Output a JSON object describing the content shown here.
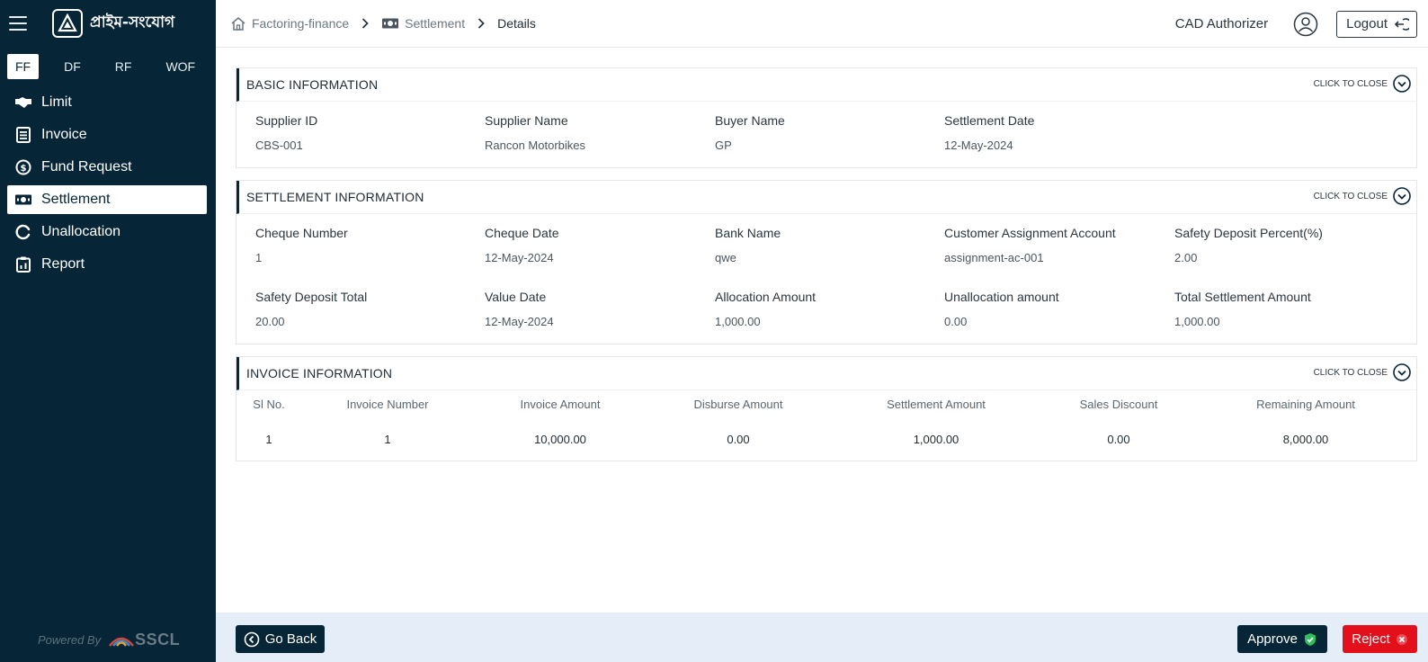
{
  "app": {
    "logo_text": "প্রাইম-সংযোগ",
    "footer_powered": "Powered By",
    "footer_brand": "SSCL"
  },
  "sidebar": {
    "tabs": [
      "FF",
      "DF",
      "RF",
      "WOF"
    ],
    "active_tab": "FF",
    "items": [
      {
        "label": "Limit",
        "icon": "handshake-icon"
      },
      {
        "label": "Invoice",
        "icon": "document-list-icon"
      },
      {
        "label": "Fund Request",
        "icon": "dollar-circle-icon"
      },
      {
        "label": "Settlement",
        "icon": "banknote-icon"
      },
      {
        "label": "Unallocation",
        "icon": "circle-notch-icon"
      },
      {
        "label": "Report",
        "icon": "clipboard-chart-icon"
      }
    ],
    "active_item": "Settlement"
  },
  "header": {
    "breadcrumb": [
      "Factoring-finance",
      "Settlement",
      "Details"
    ],
    "user_role": "CAD Authorizer",
    "logout_label": "Logout"
  },
  "basic": {
    "title": "BASIC INFORMATION",
    "toggle_label": "CLICK TO CLOSE",
    "fields": [
      {
        "label": "Supplier ID",
        "value": "CBS-001"
      },
      {
        "label": "Supplier Name",
        "value": "Rancon Motorbikes"
      },
      {
        "label": "Buyer Name",
        "value": "GP"
      },
      {
        "label": "Settlement Date",
        "value": "12-May-2024"
      }
    ]
  },
  "settlement": {
    "title": "SETTLEMENT INFORMATION",
    "toggle_label": "CLICK TO CLOSE",
    "fields": [
      {
        "label": "Cheque Number",
        "value": "1"
      },
      {
        "label": "Cheque Date",
        "value": "12-May-2024"
      },
      {
        "label": "Bank Name",
        "value": "qwe"
      },
      {
        "label": "Customer Assignment Account",
        "value": "assignment-ac-001"
      },
      {
        "label": "Safety Deposit Percent(%)",
        "value": "2.00"
      },
      {
        "label": "Safety Deposit Total",
        "value": "20.00"
      },
      {
        "label": "Value Date",
        "value": "12-May-2024"
      },
      {
        "label": "Allocation Amount",
        "value": "1,000.00"
      },
      {
        "label": "Unallocation amount",
        "value": "0.00"
      },
      {
        "label": "Total Settlement Amount",
        "value": "1,000.00"
      }
    ]
  },
  "invoice": {
    "title": "INVOICE INFORMATION",
    "toggle_label": "CLICK TO CLOSE",
    "columns": [
      "Sl No.",
      "Invoice Number",
      "Invoice Amount",
      "Disburse Amount",
      "Settlement Amount",
      "Sales Discount",
      "Remaining Amount"
    ],
    "rows": [
      [
        "1",
        "1",
        "10,000.00",
        "0.00",
        "1,000.00",
        "0.00",
        "8,000.00"
      ]
    ]
  },
  "actions": {
    "go_back": "Go Back",
    "approve": "Approve",
    "reject": "Reject"
  }
}
